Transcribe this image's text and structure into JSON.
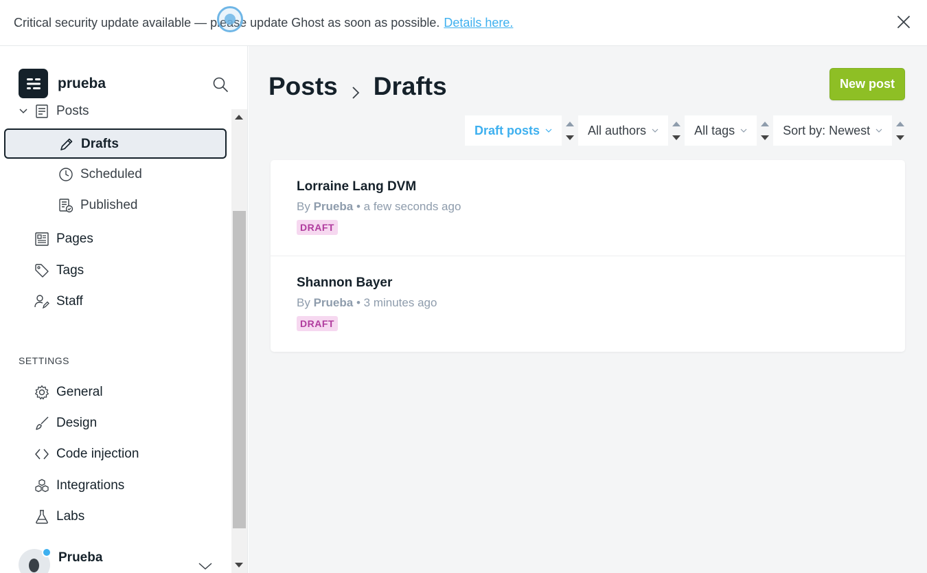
{
  "banner": {
    "text": "Critical security update available — please update Ghost as soon as possible.",
    "link": "Details here."
  },
  "sidebar": {
    "site_name": "prueba",
    "posts_label": "Posts",
    "sub_items": [
      {
        "label": "Drafts",
        "icon": "pencil-icon"
      },
      {
        "label": "Scheduled",
        "icon": "clock-icon"
      },
      {
        "label": "Published",
        "icon": "published-icon"
      }
    ],
    "items": [
      {
        "label": "Pages",
        "icon": "pages-icon"
      },
      {
        "label": "Tags",
        "icon": "tag-icon"
      },
      {
        "label": "Staff",
        "icon": "staff-icon"
      }
    ],
    "settings_label": "SETTINGS",
    "settings_items": [
      {
        "label": "General",
        "icon": "gear-icon"
      },
      {
        "label": "Design",
        "icon": "brush-icon"
      },
      {
        "label": "Code injection",
        "icon": "code-icon"
      },
      {
        "label": "Integrations",
        "icon": "integrations-icon"
      },
      {
        "label": "Labs",
        "icon": "flask-icon"
      }
    ],
    "user_name": "Prueba"
  },
  "main": {
    "breadcrumb": {
      "parent": "Posts",
      "current": "Drafts"
    },
    "new_post_label": "New post",
    "filters": {
      "type": "Draft posts",
      "author": "All authors",
      "tag": "All tags",
      "sort": "Sort by: Newest"
    },
    "posts": [
      {
        "title": "Lorraine Lang DVM",
        "by": "By",
        "author": "Prueba",
        "time": "a few seconds ago",
        "status": "DRAFT"
      },
      {
        "title": "Shannon Bayer",
        "by": "By",
        "author": "Prueba",
        "time": "3 minutes ago",
        "status": "DRAFT"
      }
    ]
  },
  "colors": {
    "accent": "#3eb0ef",
    "primary_button": "#8ebf25",
    "draft_badge_bg": "#f6d8f0",
    "draft_badge_text": "#b03c9e",
    "dark": "#15212a"
  }
}
